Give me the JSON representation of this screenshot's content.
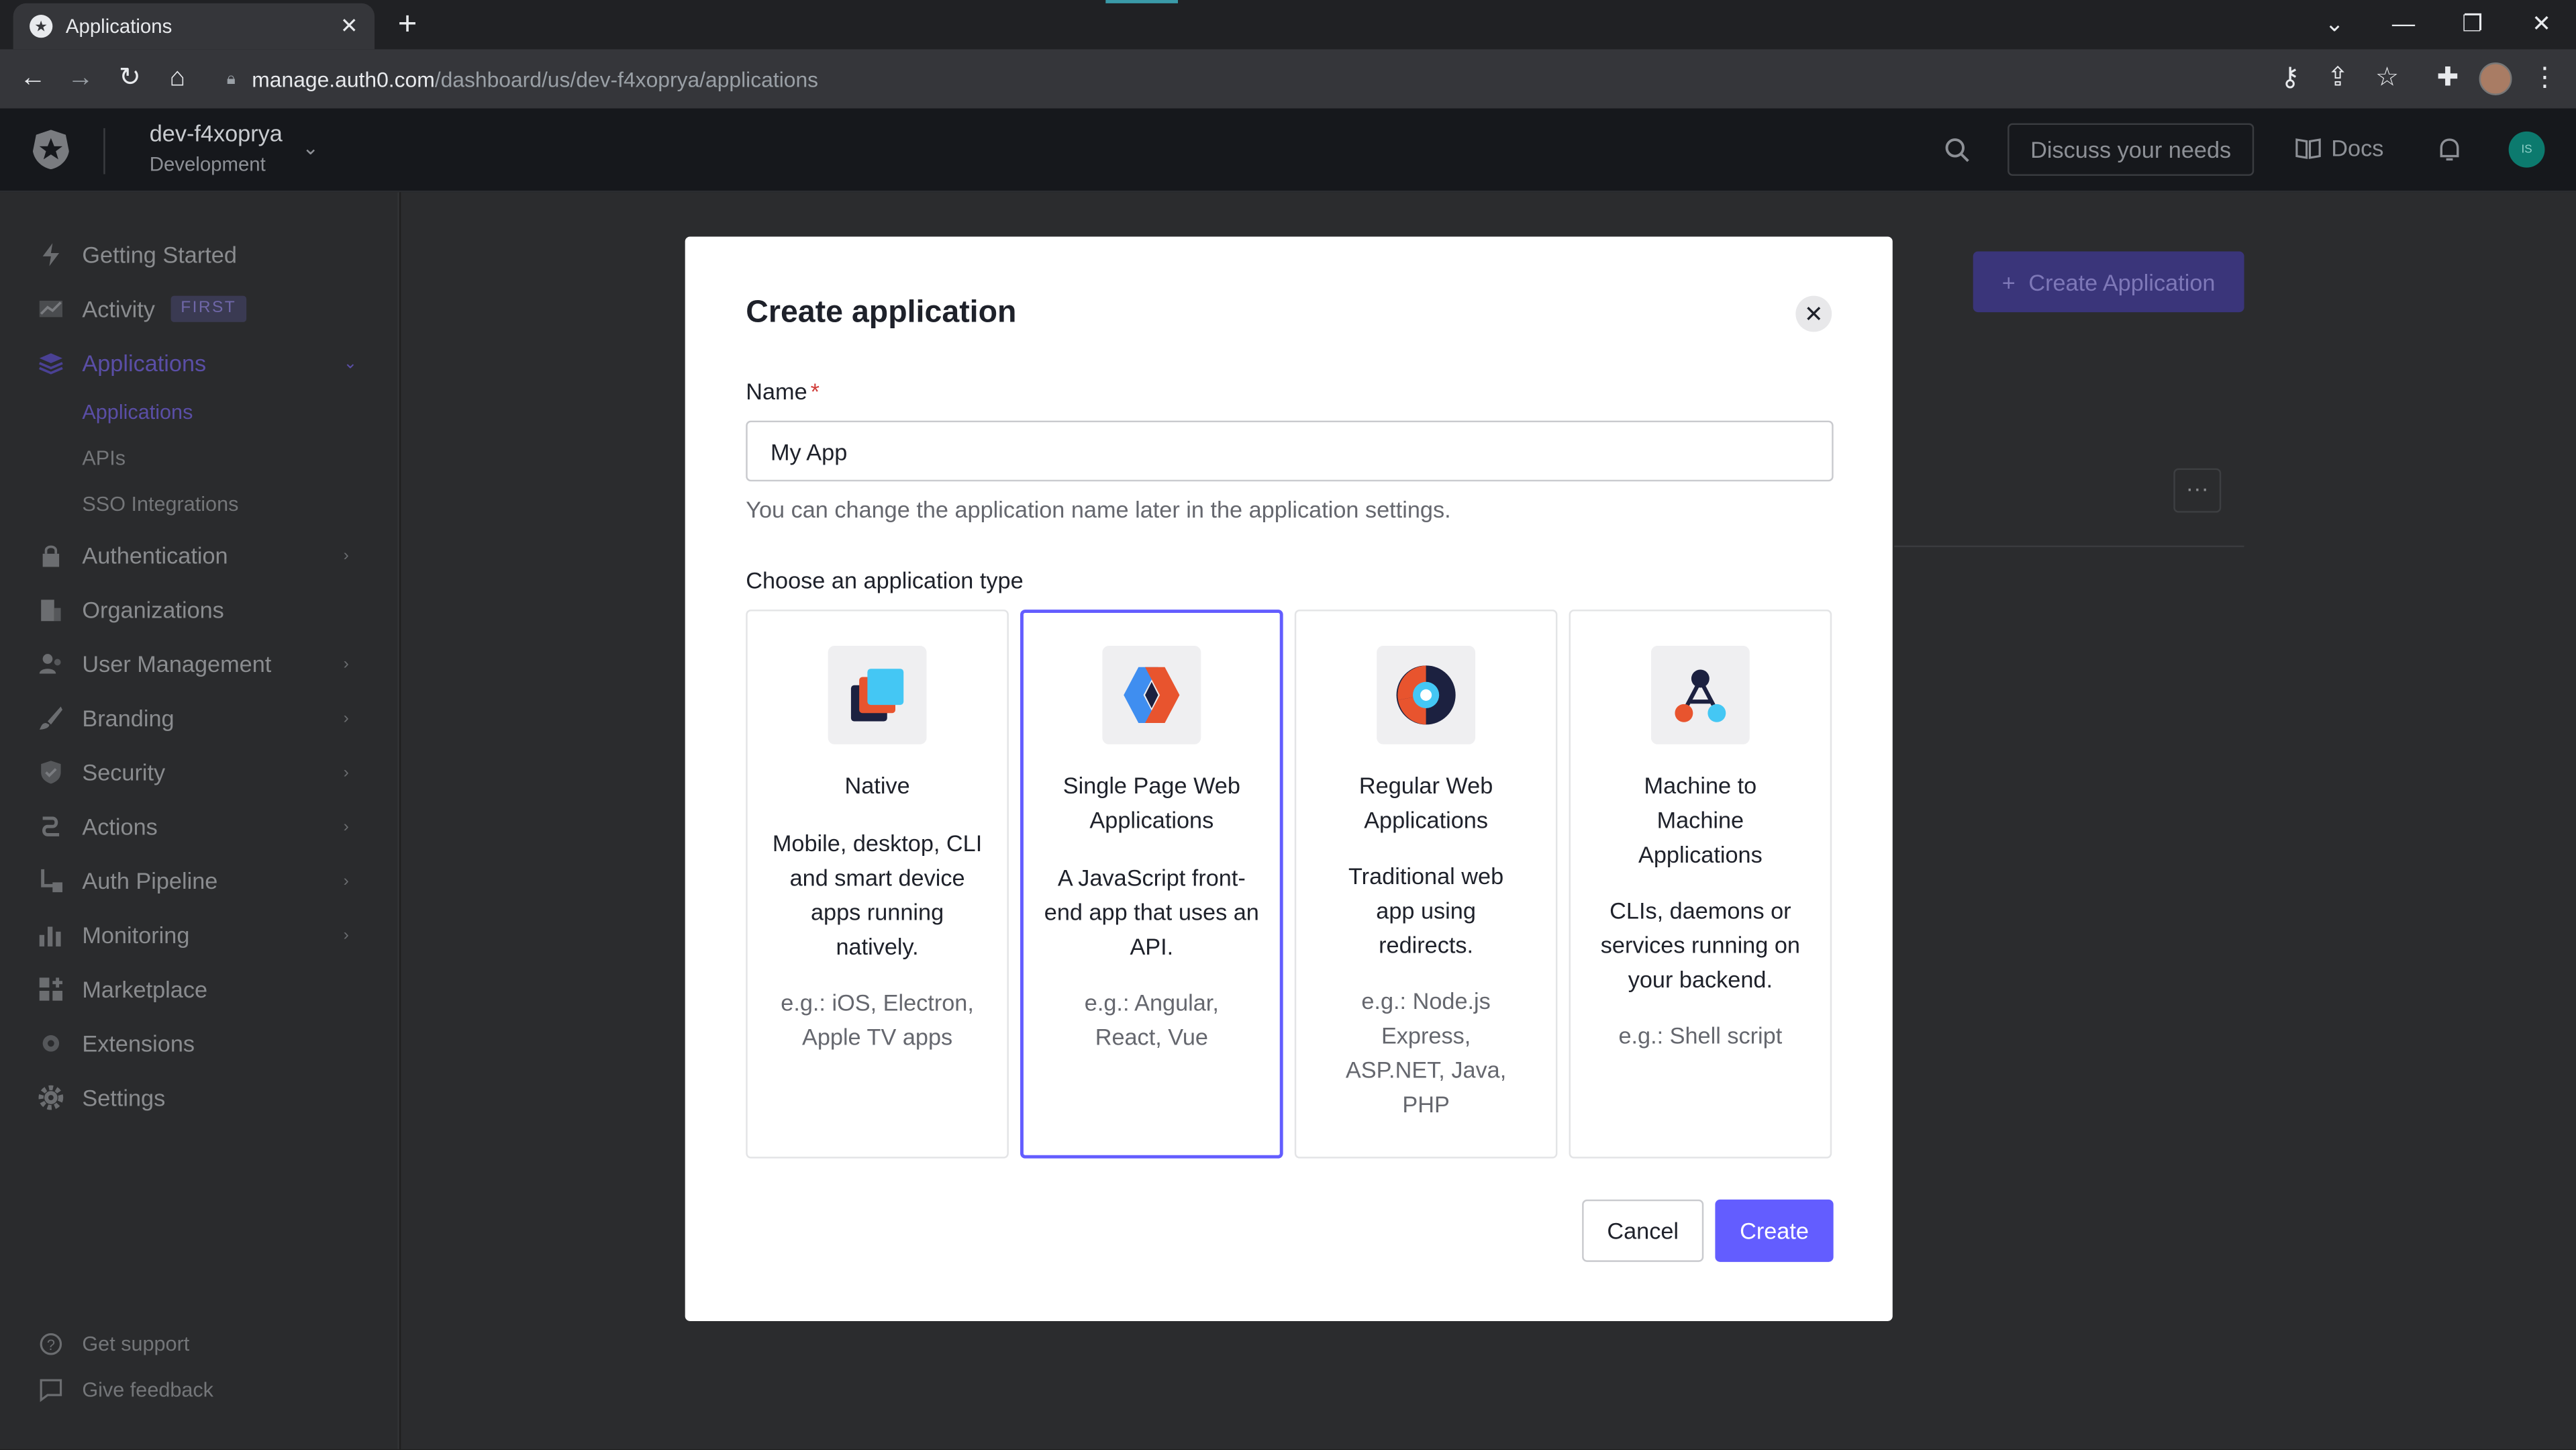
{
  "browser": {
    "tab_title": "Applications",
    "url_host": "manage.auth0.com",
    "url_path": "/dashboard/us/dev-f4xoprya/applications"
  },
  "header": {
    "tenant_name": "dev-f4xoprya",
    "tenant_env": "Development",
    "discuss_label": "Discuss your needs",
    "docs_label": "Docs",
    "user_initials": "IS"
  },
  "sidebar": {
    "items": [
      {
        "label": "Getting Started",
        "icon": "bolt-icon"
      },
      {
        "label": "Activity",
        "icon": "activity-icon",
        "badge": "FIRST"
      },
      {
        "label": "Applications",
        "icon": "layers-icon"
      },
      {
        "label": "Authentication",
        "icon": "lock-icon"
      },
      {
        "label": "Organizations",
        "icon": "building-icon"
      },
      {
        "label": "User Management",
        "icon": "users-icon"
      },
      {
        "label": "Branding",
        "icon": "brush-icon"
      },
      {
        "label": "Security",
        "icon": "shield-icon"
      },
      {
        "label": "Actions",
        "icon": "actions-icon"
      },
      {
        "label": "Auth Pipeline",
        "icon": "pipeline-icon"
      },
      {
        "label": "Monitoring",
        "icon": "bar-chart-icon"
      },
      {
        "label": "Marketplace",
        "icon": "grid-plus-icon"
      },
      {
        "label": "Extensions",
        "icon": "gear-icon"
      },
      {
        "label": "Settings",
        "icon": "gear-icon"
      }
    ],
    "sub_items": [
      "Applications",
      "APIs",
      "SSO Integrations"
    ],
    "bottom": [
      "Get support",
      "Give feedback"
    ]
  },
  "background": {
    "create_button": "Create Application",
    "more_button": "···"
  },
  "modal": {
    "title": "Create application",
    "name_label": "Name",
    "required_mark": "*",
    "name_value": "My App",
    "helper": "You can change the application name later in the application settings.",
    "type_label": "Choose an application type",
    "cards": [
      {
        "title": "Native",
        "desc": "Mobile, desktop, CLI and smart device apps running natively.",
        "eg": "e.g.: iOS, Electron, Apple TV apps"
      },
      {
        "title": "Single Page Web Applications",
        "desc": "A JavaScript front-end app that uses an API.",
        "eg": "e.g.: Angular, React, Vue"
      },
      {
        "title": "Regular Web Applications",
        "desc": "Traditional web app using redirects.",
        "eg": "e.g.: Node.js Express, ASP.NET, Java, PHP"
      },
      {
        "title": "Machine to Machine Applications",
        "desc": "CLIs, daemons or services running on your backend.",
        "eg": "e.g.: Shell script"
      }
    ],
    "cancel_label": "Cancel",
    "create_label": "Create"
  },
  "colors": {
    "accent": "#635dff",
    "required": "#d03c38"
  }
}
